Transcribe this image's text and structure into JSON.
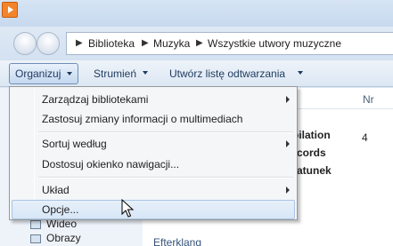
{
  "breadcrumb": {
    "items": [
      "Biblioteka",
      "Muzyka",
      "Wszystkie utwory muzyczne"
    ]
  },
  "toolbar": {
    "organize_label": "Organizuj",
    "stream_label": "Strumień",
    "create_playlist_label": "Utwórz listę odtwarzania"
  },
  "menu": {
    "items": [
      {
        "label": "Zarządzaj bibliotekami",
        "submenu": true
      },
      {
        "label": "Zastosuj zmiany informacji o multimediach",
        "submenu": false
      },
      {
        "label": "Sortuj według",
        "submenu": true
      },
      {
        "label": "Dostosuj okienko nawigacji...",
        "submenu": false
      },
      {
        "label": "Układ",
        "submenu": true
      },
      {
        "label": "Opcje...",
        "submenu": false,
        "highlighted": true
      }
    ]
  },
  "list_header": {
    "col_nr": "Nr"
  },
  "background": {
    "text_1": "pilation",
    "text_2": "cords",
    "text_3": "atunek",
    "nr_value": "4",
    "nav_item_1": "Wideo",
    "nav_item_2": "Obrazy",
    "text_4": "Efterklang"
  },
  "colors": {
    "accent": "#6f8fb5",
    "highlight": "#d7e6f6",
    "menu_bg": "#f5f6f8",
    "app_icon": "#f2852b"
  }
}
